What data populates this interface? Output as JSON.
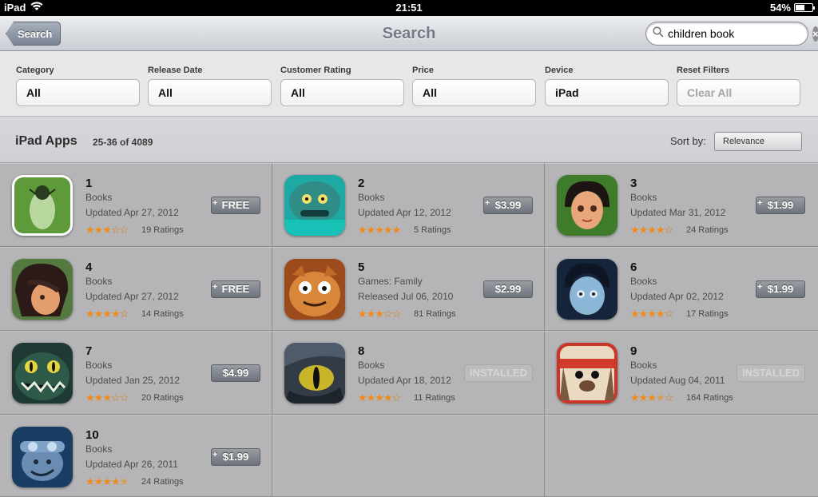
{
  "status_bar": {
    "carrier": "iPad",
    "time": "21:51",
    "battery": "54%",
    "battery_level": 0.54
  },
  "nav": {
    "back_label": "Search",
    "title": "Search",
    "search_value": "children book"
  },
  "filters": [
    {
      "label": "Category",
      "value": "All"
    },
    {
      "label": "Release Date",
      "value": "All"
    },
    {
      "label": "Customer Rating",
      "value": "All"
    },
    {
      "label": "Price",
      "value": "All"
    },
    {
      "label": "Device",
      "value": "iPad"
    },
    {
      "label": "Reset Filters",
      "value": "Clear All"
    }
  ],
  "section": {
    "title": "iPad Apps",
    "count": "25-36 of 4089",
    "sort_label": "Sort by:",
    "sort_value": "Relevance"
  },
  "apps": [
    {
      "rank": "1",
      "category": "Books",
      "updated": "Updated Apr 27, 2012",
      "stars": 3,
      "half": false,
      "ratings": "19 Ratings",
      "price": "FREE",
      "plus": true,
      "installed": false
    },
    {
      "rank": "2",
      "category": "Books",
      "updated": "Updated Apr 12, 2012",
      "stars": 5,
      "half": false,
      "ratings": "5 Ratings",
      "price": "$3.99",
      "plus": true,
      "installed": false
    },
    {
      "rank": "3",
      "category": "Books",
      "updated": "Updated Mar 31, 2012",
      "stars": 4,
      "half": false,
      "ratings": "24 Ratings",
      "price": "$1.99",
      "plus": true,
      "installed": false
    },
    {
      "rank": "4",
      "category": "Books",
      "updated": "Updated Apr 27, 2012",
      "stars": 4,
      "half": false,
      "ratings": "14 Ratings",
      "price": "FREE",
      "plus": true,
      "installed": false
    },
    {
      "rank": "5",
      "category": "Games: Family",
      "updated": "Released Jul 06, 2010",
      "stars": 3,
      "half": false,
      "ratings": "81 Ratings",
      "price": "$2.99",
      "plus": false,
      "installed": false
    },
    {
      "rank": "6",
      "category": "Books",
      "updated": "Updated Apr 02, 2012",
      "stars": 4,
      "half": false,
      "ratings": "17 Ratings",
      "price": "$1.99",
      "plus": true,
      "installed": false
    },
    {
      "rank": "7",
      "category": "Books",
      "updated": "Updated Jan 25, 2012",
      "stars": 3,
      "half": false,
      "ratings": "20 Ratings",
      "price": "$4.99",
      "plus": false,
      "installed": false
    },
    {
      "rank": "8",
      "category": "Books",
      "updated": "Updated Apr 18, 2012",
      "stars": 4,
      "half": false,
      "ratings": "11 Ratings",
      "price": "INSTALLED",
      "plus": false,
      "installed": true
    },
    {
      "rank": "9",
      "category": "Books",
      "updated": "Updated Aug 04, 2011",
      "stars": 3,
      "half": true,
      "ratings": "164 Ratings",
      "price": "INSTALLED",
      "plus": false,
      "installed": true
    },
    {
      "rank": "10",
      "category": "Books",
      "updated": "Updated Apr 26, 2011",
      "stars": 4,
      "half": true,
      "ratings": "24 Ratings",
      "price": "$1.99",
      "plus": true,
      "installed": false
    }
  ],
  "icon_names": [
    "alien-app-icon",
    "monster-app-icon",
    "girl-app-icon",
    "girl-profile-app-icon",
    "tabby-cat-app-icon",
    "zombie-girl-app-icon",
    "green-monster-app-icon",
    "dragon-eye-app-icon",
    "pug-app-icon",
    "goggles-boy-app-icon"
  ],
  "colors": {
    "star_on": "#f08a18",
    "star_off": "#b0b0b0",
    "price_button": "#7d828a"
  }
}
